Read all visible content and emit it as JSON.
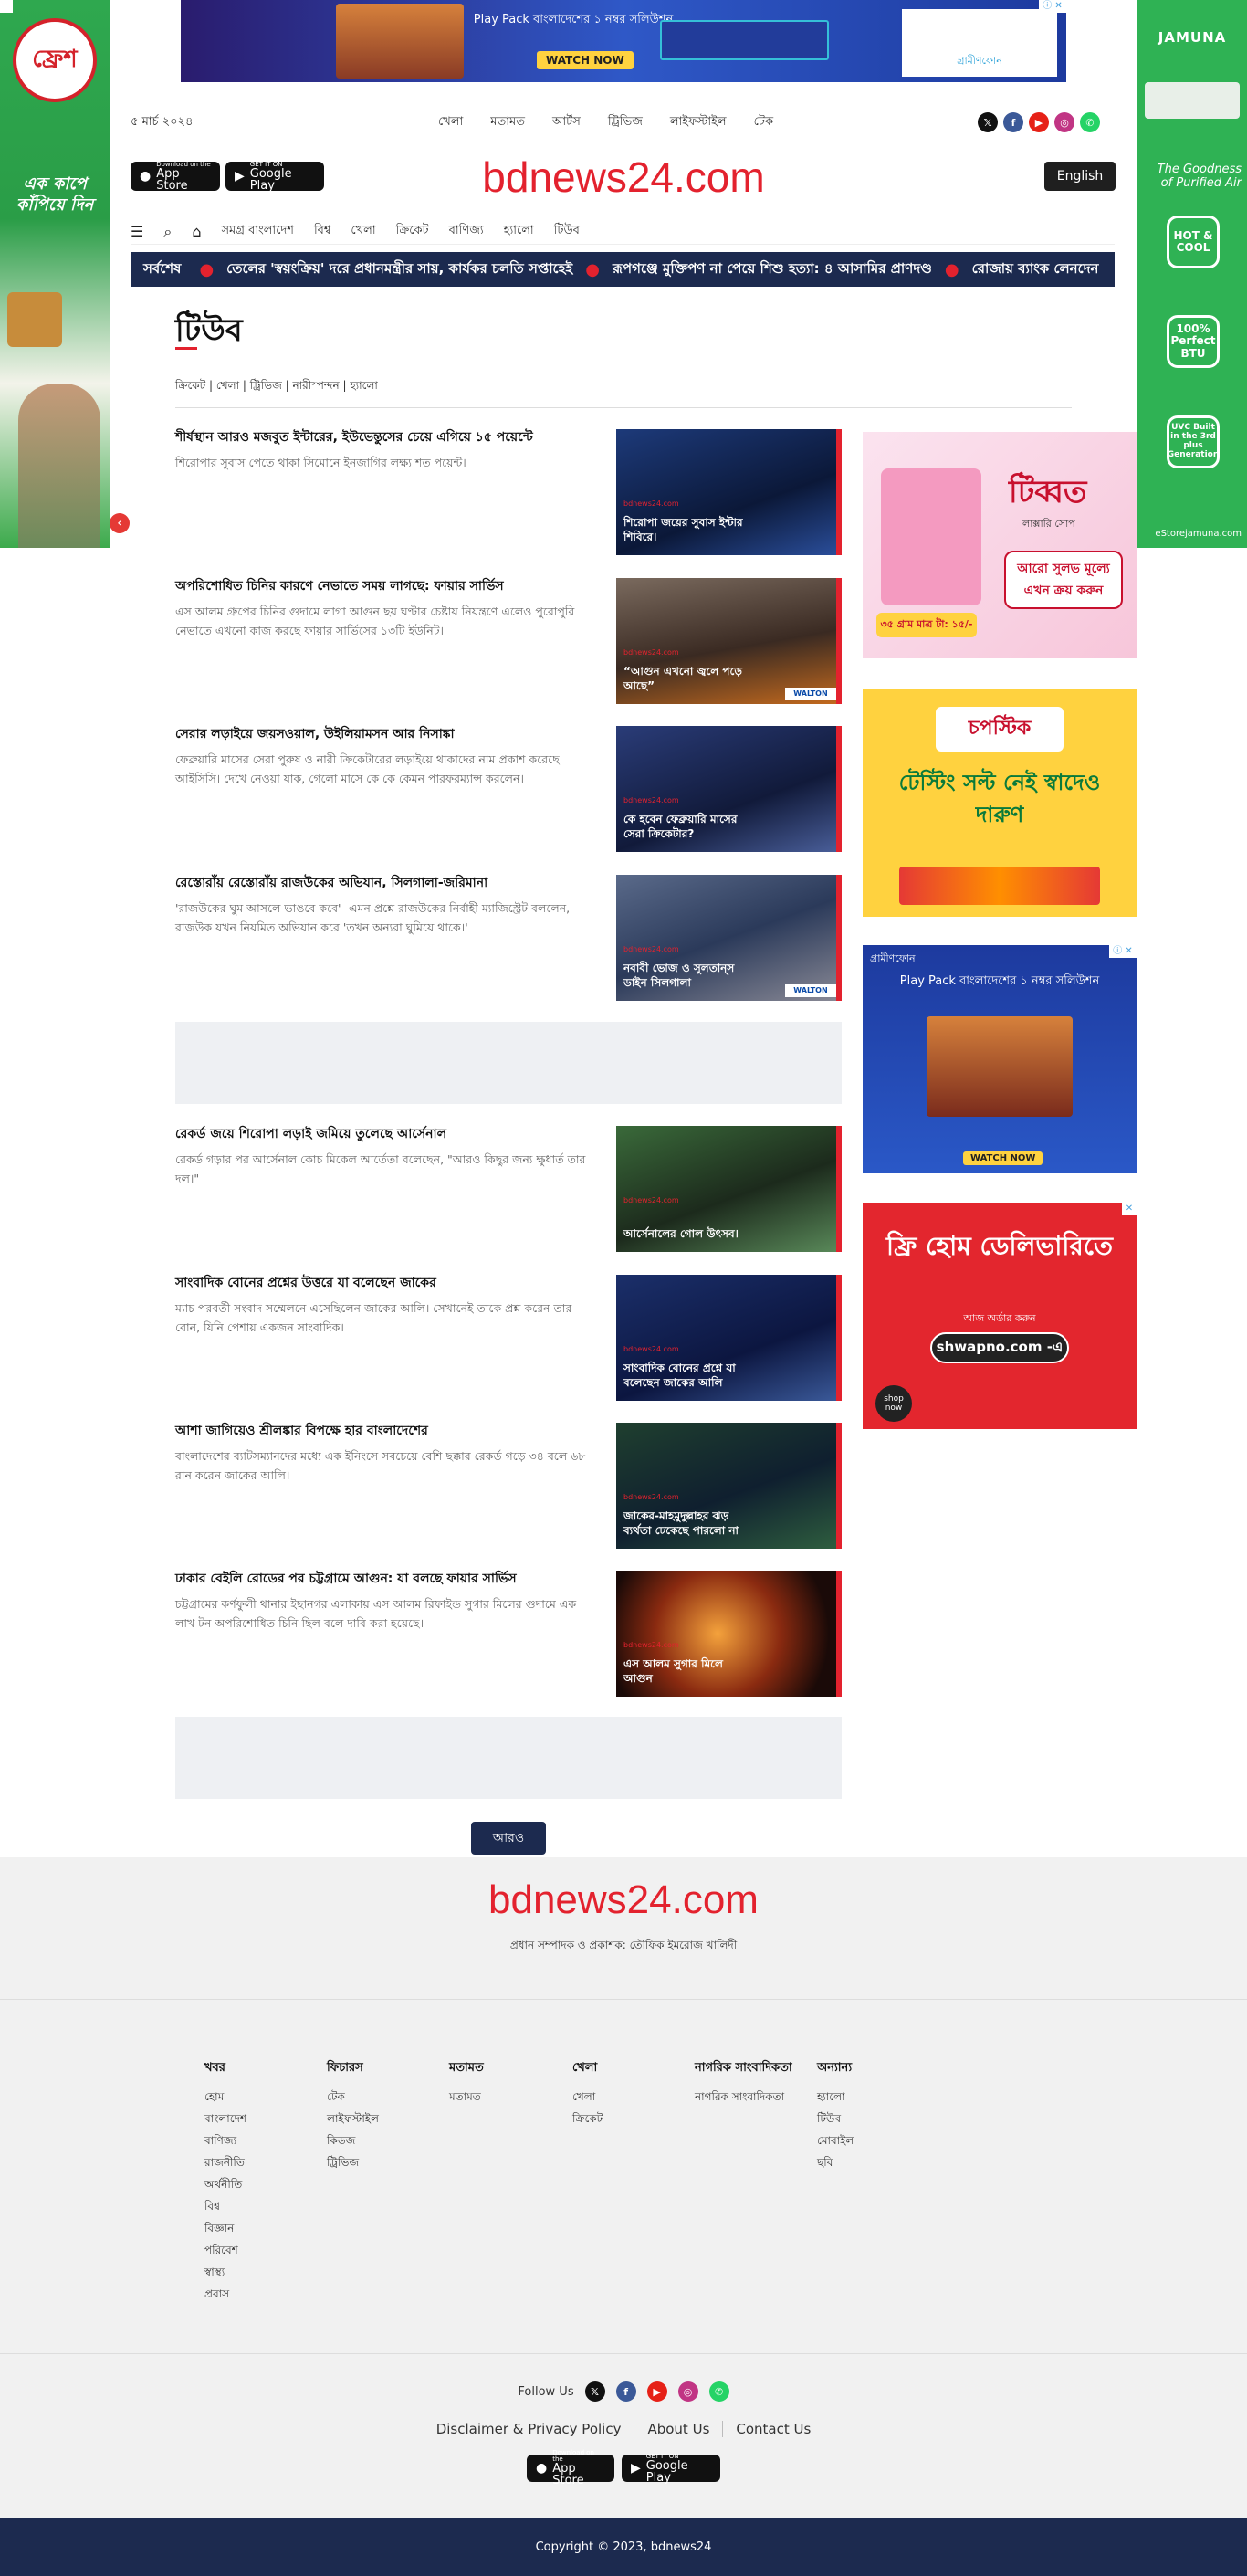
{
  "top_ad": {
    "text": "Play Pack বাংলাদেশের ১ নম্বর সলিউশন",
    "cta": "WATCH NOW",
    "brand": "গ্রামীণফোন"
  },
  "side_left_ad": {
    "brand": "ফ্রেশ",
    "slogan": "এক কাপে কাঁপিয়ে দিন"
  },
  "side_right_ad": {
    "brand": "JAMUNA",
    "tagline": "The Goodness of Purified Air",
    "badges": [
      "HOT & COOL",
      "100% Perfect BTU",
      "UVC Built in the 3rd plus Generation"
    ],
    "store": "eStorejamuna.com"
  },
  "header": {
    "date": "৫ মার্চ ২০২৪",
    "top_nav": [
      "খেলা",
      "মতামত",
      "আর্টস",
      "ট্রিভিজ",
      "লাইফস্টাইল",
      "টেক"
    ],
    "app_store": "App Store",
    "app_store_small": "Download on the",
    "google_play": "Google Play",
    "google_play_small": "GET IT ON",
    "masthead": "bdnews24.com",
    "lang_button": "English"
  },
  "nav": [
    "সমগ্র বাংলাদেশ",
    "বিশ্ব",
    "খেলা",
    "ক্রিকেট",
    "বাণিজ্য",
    "হ্যালো",
    "টিউব"
  ],
  "ticker": {
    "label": "সর্বশেষ",
    "items": [
      "তেলের 'স্বয়ংক্রিয়' দরে প্রধানমন্ত্রীর সায়, কার্যকর চলতি সপ্তাহেই",
      "রূপগঞ্জে মুক্তিপণ না পেয়ে শিশু হত্যা: ৪ আসামির প্রাণদণ্ড",
      "রোজায় ব্যাংক লেনদেন"
    ]
  },
  "section": {
    "title": "টিউব",
    "subcats": "ক্রিকেট | খেলা | ট্রিভিজ | নারীস্পন্দন | হ্যালো"
  },
  "articles": [
    {
      "title": "শীর্ষস্থান আরও মজবুত ইন্টারের, ইউভেন্তুসের চেয়ে এগিয়ে ১৫ পয়েন্টে",
      "summary": "শিরোপার সুবাস পেতে থাকা সিমোনে ইনজাগির লক্ষ্য শত পয়েন্ট।",
      "caption": "শিরোপা জয়ের সুবাস ইন্টার শিবিরে।",
      "walton": false
    },
    {
      "title": "অপরিশোধিত চিনির কারণে নেভাতে সময় লাগছে: ফায়ার সার্ভিস",
      "summary": "এস আলম গ্রুপের চিনির গুদামে লাগা আগুন ছয় ঘণ্টার চেষ্টায় নিয়ন্ত্রণে এলেও পুরোপুরি নেভাতে এখনো কাজ করছে ফায়ার সার্ভিসের ১৩টি ইউনিট।",
      "caption": "“আগুন এখনো জ্বলে পড়ে আছে”",
      "walton": true
    },
    {
      "title": "সেরার লড়াইয়ে জয়সওয়াল, উইলিয়ামসন আর নিসাঙ্কা",
      "summary": "ফেব্রুয়ারি মাসের সেরা পুরুষ ও নারী ক্রিকেটারের লড়াইয়ে থাকাদের নাম প্রকাশ করেছে আইসিসি। দেখে নেওয়া যাক, গেলো মাসে কে কে কেমন পারফরম্যান্স করলেন।",
      "caption": "কে হবেন ফেব্রুয়ারি মাসের সেরা ক্রিকেটার?",
      "walton": false
    },
    {
      "title": "রেস্তোরাঁয় রেস্তোরাঁয় রাজউকের অভিযান, সিলগালা-জরিমানা",
      "summary": "'রাজউকের ঘুম আসলে ভাঙবে কবে'- এমন প্রশ্নে রাজউকের নির্বাহী ম্যাজিস্ট্রেট বললেন, রাজউক যখন নিয়মিত অভিযান করে 'তখন অন্যরা ঘুমিয়ে থাকে।'",
      "caption": "নবাবী ভোজ ও সুলতান্‌স ডাইন সিলগালা",
      "walton": true
    },
    {
      "title": "রেকর্ড জয়ে শিরোপা লড়াই জমিয়ে তুলেছে আর্সেনাল",
      "summary": "রেকর্ড গড়ার পর আর্সেনাল কোচ মিকেল আর্তেতা বলেছেন, \"আরও কিছুর জন্য ক্ষুধার্ত তার দল।\"",
      "caption": "আর্সেনালের গোল উৎসব।",
      "walton": false
    },
    {
      "title": "সাংবাদিক বোনের প্রশ্নের উত্তরে যা বলেছেন জাকের",
      "summary": "ম্যাচ পরবর্তী সংবাদ সম্মেলনে এসেছিলেন জাকের আলি। সেখানেই তাকে প্রশ্ন করেন তার বোন, যিনি পেশায় একজন সাংবাদিক।",
      "caption": "সাংবাদিক বোনের প্রশ্নে যা বলেছেন জাকের আলি",
      "walton": false
    },
    {
      "title": "আশা জাগিয়েও শ্রীলঙ্কার বিপক্ষে হার বাংলাদেশের",
      "summary": "বাংলাদেশের ব্যাটসম্যানদের মধ্যে এক ইনিংসে সবচেয়ে বেশি ছক্কার রেকর্ড গড়ে ৩৪ বলে ৬৮ রান করেন জাকের আলি।",
      "caption": "জাকের-মাহমুদুল্লাহর ঝড় ব্যর্থতা ঢেকেছে পারলো না",
      "walton": false
    },
    {
      "title": "ঢাকার বেইলি রোডের পর চট্টগ্রামে আগুন: যা বলছে ফায়ার সার্ভিস",
      "summary": "চট্টগ্রামের কর্ণফুলী থানার ইছানগর এলাকায় এস আলম রিফাইন্ড সুগার মিলের গুদামে এক লাখ টন অপরিশোধিত চিনি ছিল বলে দাবি করা হয়েছে।",
      "caption": "এস আলম সুগার মিলে আগুন",
      "walton": false
    }
  ],
  "image_tag": "bdnews24.com",
  "walton_label": "WALTON",
  "more_button": "আরও",
  "right_ads": [
    {
      "brand": "টিব্বত",
      "sub": "লাক্সারি সোপ",
      "cta": "আরো সুলভ মূল্যে এখন ক্রয় করুন",
      "price": "৩৫ গ্রাম মাত্র টা: ১৫/-"
    },
    {
      "brand": "চপস্টিক",
      "headline": "টেস্টিং সল্ট নেই স্বাদেও দারুণ"
    },
    {
      "brand": "গ্রামীণফোন",
      "text": "Play Pack বাংলাদেশের ১ নম্বর সলিউশন",
      "cta": "WATCH NOW"
    },
    {
      "headline": "ফ্রি হোম ডেলিভারিতে",
      "sub": "আজ অর্ডার করুন",
      "url": "shwapno.com -এ",
      "badge": "shop now"
    }
  ],
  "footer": {
    "masthead": "bdnews24.com",
    "editor": "প্রধান সম্পাদক ও প্রকাশক: তৌফিক ইমরোজ খালিদী",
    "columns": [
      {
        "heading": "খবর",
        "links": [
          "হোম",
          "বাংলাদেশ",
          "বাণিজ্য",
          "রাজনীতি",
          "অর্থনীতি",
          "বিশ্ব",
          "বিজ্ঞান",
          "পরিবেশ",
          "স্বাস্থ্য",
          "প্রবাস"
        ]
      },
      {
        "heading": "ফিচারস",
        "links": [
          "টেক",
          "লাইফস্টাইল",
          "কিডজ",
          "ট্রিভিজ"
        ]
      },
      {
        "heading": "মতামত",
        "links": [
          "মতামত"
        ]
      },
      {
        "heading": "খেলা",
        "links": [
          "খেলা",
          "ক্রিকেট"
        ]
      },
      {
        "heading": "নাগরিক সাংবাদিকতা",
        "links": [
          "নাগরিক সাংবাদিকতা"
        ]
      },
      {
        "heading": "অন্যান্য",
        "links": [
          "হ্যালো",
          "টিউব",
          "মোবাইল",
          "ছবি"
        ]
      }
    ],
    "follow_label": "Follow Us",
    "policy_links": [
      "Disclaimer & Privacy Policy",
      "About Us",
      "Contact Us"
    ],
    "copyright": "Copyright © 2023, bdnews24"
  },
  "colors": {
    "brand_red": "#e3222e",
    "navy": "#1c2a4f"
  }
}
